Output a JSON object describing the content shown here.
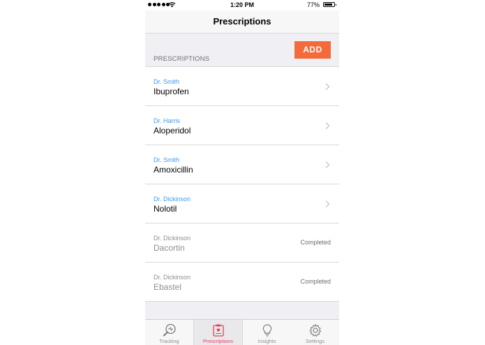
{
  "status_bar": {
    "time": "1:20 PM",
    "battery_percent": "77%"
  },
  "nav": {
    "title": "Prescriptions"
  },
  "section": {
    "header": "PRESCRIPTIONS",
    "add_label": "ADD"
  },
  "prescriptions": [
    {
      "doctor": "Dr. Smith",
      "drug": "Ibuprofen",
      "status": ""
    },
    {
      "doctor": "Dr. Harris",
      "drug": "Aloperidol",
      "status": ""
    },
    {
      "doctor": "Dr. Smith",
      "drug": "Amoxicillin",
      "status": ""
    },
    {
      "doctor": "Dr. Dickinson",
      "drug": "Nolotil",
      "status": ""
    },
    {
      "doctor": "Dr. Dickinson",
      "drug": "Dacortin",
      "status": "Completed"
    },
    {
      "doctor": "Dr. Dickinson",
      "drug": "Ebastel",
      "status": "Completed"
    }
  ],
  "tabs": [
    {
      "label": "Tracking",
      "icon": "tracking-icon"
    },
    {
      "label": "Prescriptions",
      "icon": "prescriptions-icon"
    },
    {
      "label": "Insights",
      "icon": "lightbulb-icon"
    },
    {
      "label": "Settings",
      "icon": "gear-icon"
    }
  ],
  "colors": {
    "accent_blue": "#3d9be9",
    "add_button": "#f36b3a",
    "active_tab": "#e2405c",
    "background": "#efeff4"
  }
}
